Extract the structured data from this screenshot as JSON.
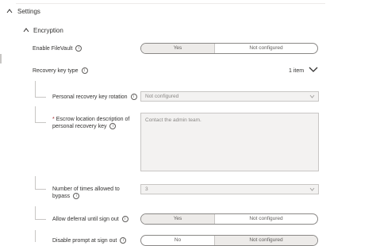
{
  "settings": {
    "title": "Settings"
  },
  "encryption": {
    "title": "Encryption"
  },
  "fields": {
    "enable_filevault": {
      "label": "Enable FileVault",
      "yes": "Yes",
      "no": "Not configured"
    },
    "recovery_key_type": {
      "label": "Recovery key type",
      "count": "1 item"
    },
    "personal_rotation": {
      "label": "Personal recovery key rotation",
      "value": "Not configured"
    },
    "escrow_location": {
      "asterisk": "*",
      "label_line1": "Escrow location description of",
      "label_line2": "personal recovery key",
      "placeholder": "Contact the admin team."
    },
    "times_bypass": {
      "label_line1": "Number of times allowed to",
      "label_line2": "bypass",
      "value": "3"
    },
    "allow_deferral": {
      "label": "Allow deferral until sign out",
      "yes": "Yes",
      "no": "Not configured"
    },
    "disable_prompt": {
      "label": "Disable prompt at sign out",
      "yes": "No",
      "no": "Not configured"
    }
  }
}
